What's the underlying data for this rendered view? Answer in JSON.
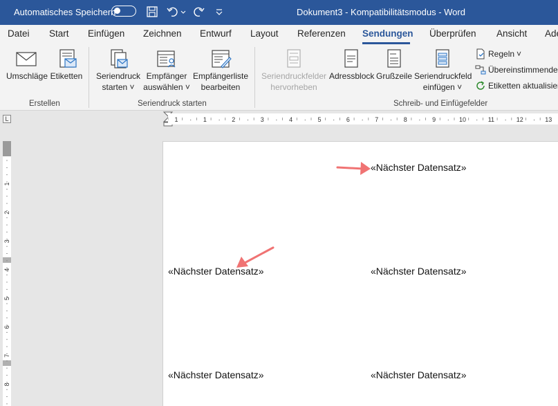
{
  "titlebar": {
    "autosave_label": "Automatisches Speichern",
    "autosave_state": "off",
    "document_title": "Dokument3  -  Kompatibilitätsmodus  -  Word",
    "quick_access": [
      "save-icon",
      "undo-icon",
      "redo-icon",
      "customize-icon"
    ]
  },
  "tabs": [
    {
      "label": "Datei"
    },
    {
      "label": "Start"
    },
    {
      "label": "Einfügen"
    },
    {
      "label": "Zeichnen"
    },
    {
      "label": "Entwurf"
    },
    {
      "label": "Layout"
    },
    {
      "label": "Referenzen"
    },
    {
      "label": "Sendungen",
      "active": true
    },
    {
      "label": "Überprüfen"
    },
    {
      "label": "Ansicht"
    },
    {
      "label": "Ade"
    }
  ],
  "ribbon": {
    "groups": [
      {
        "label": "Erstellen"
      },
      {
        "label": "Seriendruck starten"
      },
      {
        "label": "Schreib- und Einfügefelder"
      }
    ],
    "erstellen": {
      "umschlaege": "Umschläge",
      "etiketten": "Etiketten"
    },
    "seriendruck": {
      "starten_l1": "Seriendruck",
      "starten_l2": "starten",
      "empfaenger_l1": "Empfänger",
      "empfaenger_l2": "auswählen",
      "liste_l1": "Empfängerliste",
      "liste_l2": "bearbeiten"
    },
    "felder": {
      "hervorheben_l1": "Seriendruckfelder",
      "hervorheben_l2": "hervorheben",
      "adressblock": "Adressblock",
      "grusszeile": "Grußzeile",
      "einfuegen_l1": "Seriendruckfeld",
      "einfuegen_l2": "einfügen",
      "regeln": "Regeln",
      "uebereinstimmende": "Übereinstimmende",
      "etiketten_aktualisieren": "Etiketten aktualisier"
    }
  },
  "ruler": {
    "h_labels": [
      "1",
      "·",
      "1",
      "·",
      "2",
      "·",
      "3",
      "·",
      "4",
      "·",
      "5",
      "·",
      "6",
      "·",
      "7",
      "·",
      "8",
      "·",
      "9",
      "·",
      "10",
      "·",
      "11",
      "·",
      "12",
      "·",
      "13"
    ],
    "v_labels": [
      "1",
      "2",
      "3",
      "4",
      "5",
      "6",
      "7",
      "8"
    ]
  },
  "document": {
    "fields": [
      "«Nächster Datensatz»",
      "«Nächster Datensatz»",
      "«Nächster Datensatz»",
      "«Nächster Datensatz»",
      "«Nächster Datensatz»"
    ]
  },
  "colors": {
    "accent": "#2b579a",
    "annotation_arrow": "#f07373"
  }
}
